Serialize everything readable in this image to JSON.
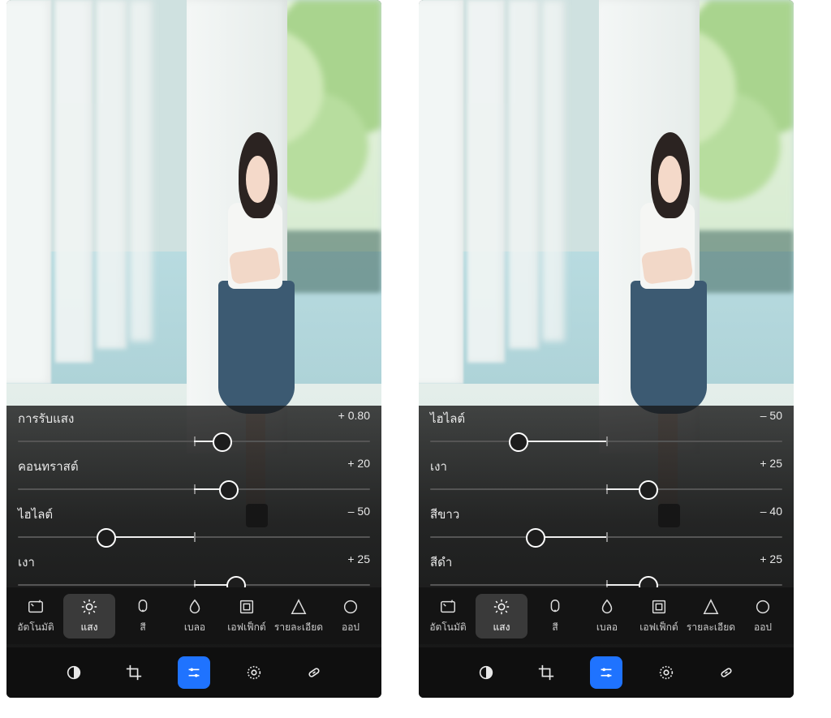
{
  "screens": [
    {
      "sliders": [
        {
          "label": "การรับแสง",
          "value": "+ 0.80",
          "pos": 58,
          "center": 50
        },
        {
          "label": "คอนทราสต์",
          "value": "+ 20",
          "pos": 60,
          "center": 50
        },
        {
          "label": "ไฮไลต์",
          "value": "– 50",
          "pos": 25,
          "center": 50
        },
        {
          "label": "เงา",
          "value": "+ 25",
          "pos": 62,
          "center": 50
        }
      ]
    },
    {
      "sliders": [
        {
          "label": "ไฮไลต์",
          "value": "– 50",
          "pos": 25,
          "center": 50
        },
        {
          "label": "เงา",
          "value": "+ 25",
          "pos": 62,
          "center": 50
        },
        {
          "label": "สีขาว",
          "value": "– 40",
          "pos": 30,
          "center": 50
        },
        {
          "label": "สีดำ",
          "value": "+ 25",
          "pos": 62,
          "center": 50
        }
      ]
    }
  ],
  "categories": [
    {
      "key": "auto",
      "label": "อัตโนมัติ"
    },
    {
      "key": "light",
      "label": "แสง",
      "selected": true
    },
    {
      "key": "color",
      "label": "สี"
    },
    {
      "key": "blur",
      "label": "เบลอ"
    },
    {
      "key": "effect",
      "label": "เอฟเฟ็กต์"
    },
    {
      "key": "detail",
      "label": "รายละเอียด"
    },
    {
      "key": "optics",
      "label": "ออป"
    }
  ],
  "tools": [
    {
      "key": "presets"
    },
    {
      "key": "crop"
    },
    {
      "key": "adjust",
      "active": true
    },
    {
      "key": "mask"
    },
    {
      "key": "heal"
    }
  ]
}
